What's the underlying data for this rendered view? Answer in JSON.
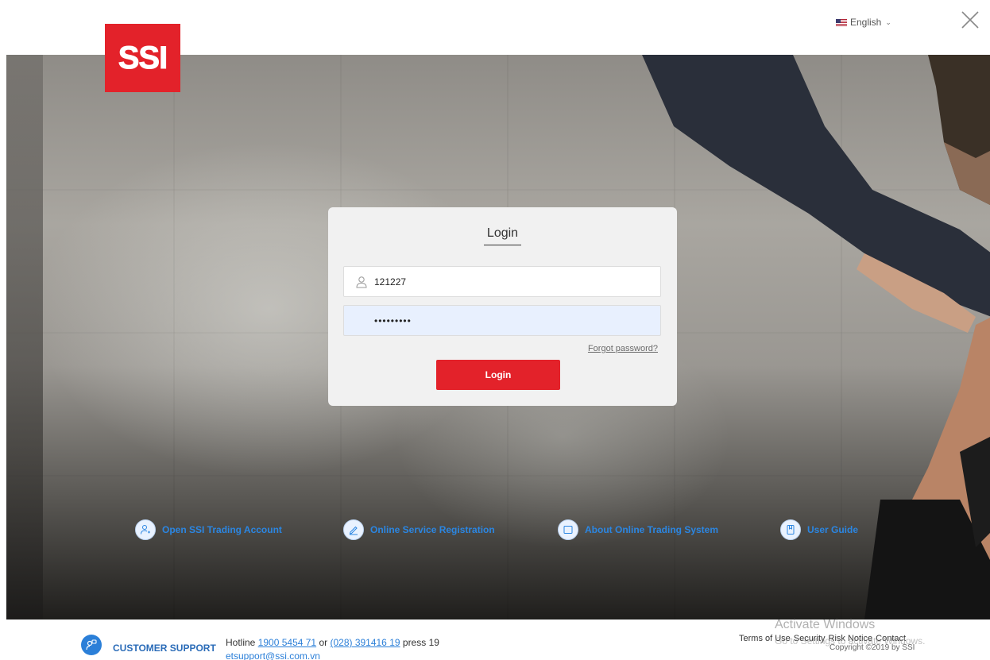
{
  "header": {
    "language_label": "English",
    "logo_text": "SSI"
  },
  "login": {
    "title": "Login",
    "username_value": "121227",
    "password_value": "•••••••••",
    "forgot_label": "Forgot password?",
    "submit_label": "Login"
  },
  "links": [
    {
      "label": "Open SSI Trading Account",
      "icon": "add-user-icon"
    },
    {
      "label": "Online Service Registration",
      "icon": "pen-icon"
    },
    {
      "label": "About Online Trading System",
      "icon": "monitor-icon"
    },
    {
      "label": "User Guide",
      "icon": "book-icon"
    }
  ],
  "footer": {
    "support_label": "CUSTOMER SUPPORT",
    "hotline_prefix": "Hotline",
    "hotline_number1": "1900 5454 71",
    "hotline_or": "or",
    "hotline_number2": "(028) 391416 19",
    "hotline_suffix": "press 19",
    "email": "etsupport@ssi.com.vn",
    "terms": "Terms of Use",
    "security": "Security",
    "risk_notice": "Risk Notice",
    "contact": "Contact",
    "copyright": "Copyright ©2019 by SSI"
  },
  "watermark": {
    "line1": "Activate Windows",
    "line2": "Go to Settings to activate Windows."
  },
  "colors": {
    "brand_red": "#e3222a",
    "link_blue": "#2b86e2"
  }
}
